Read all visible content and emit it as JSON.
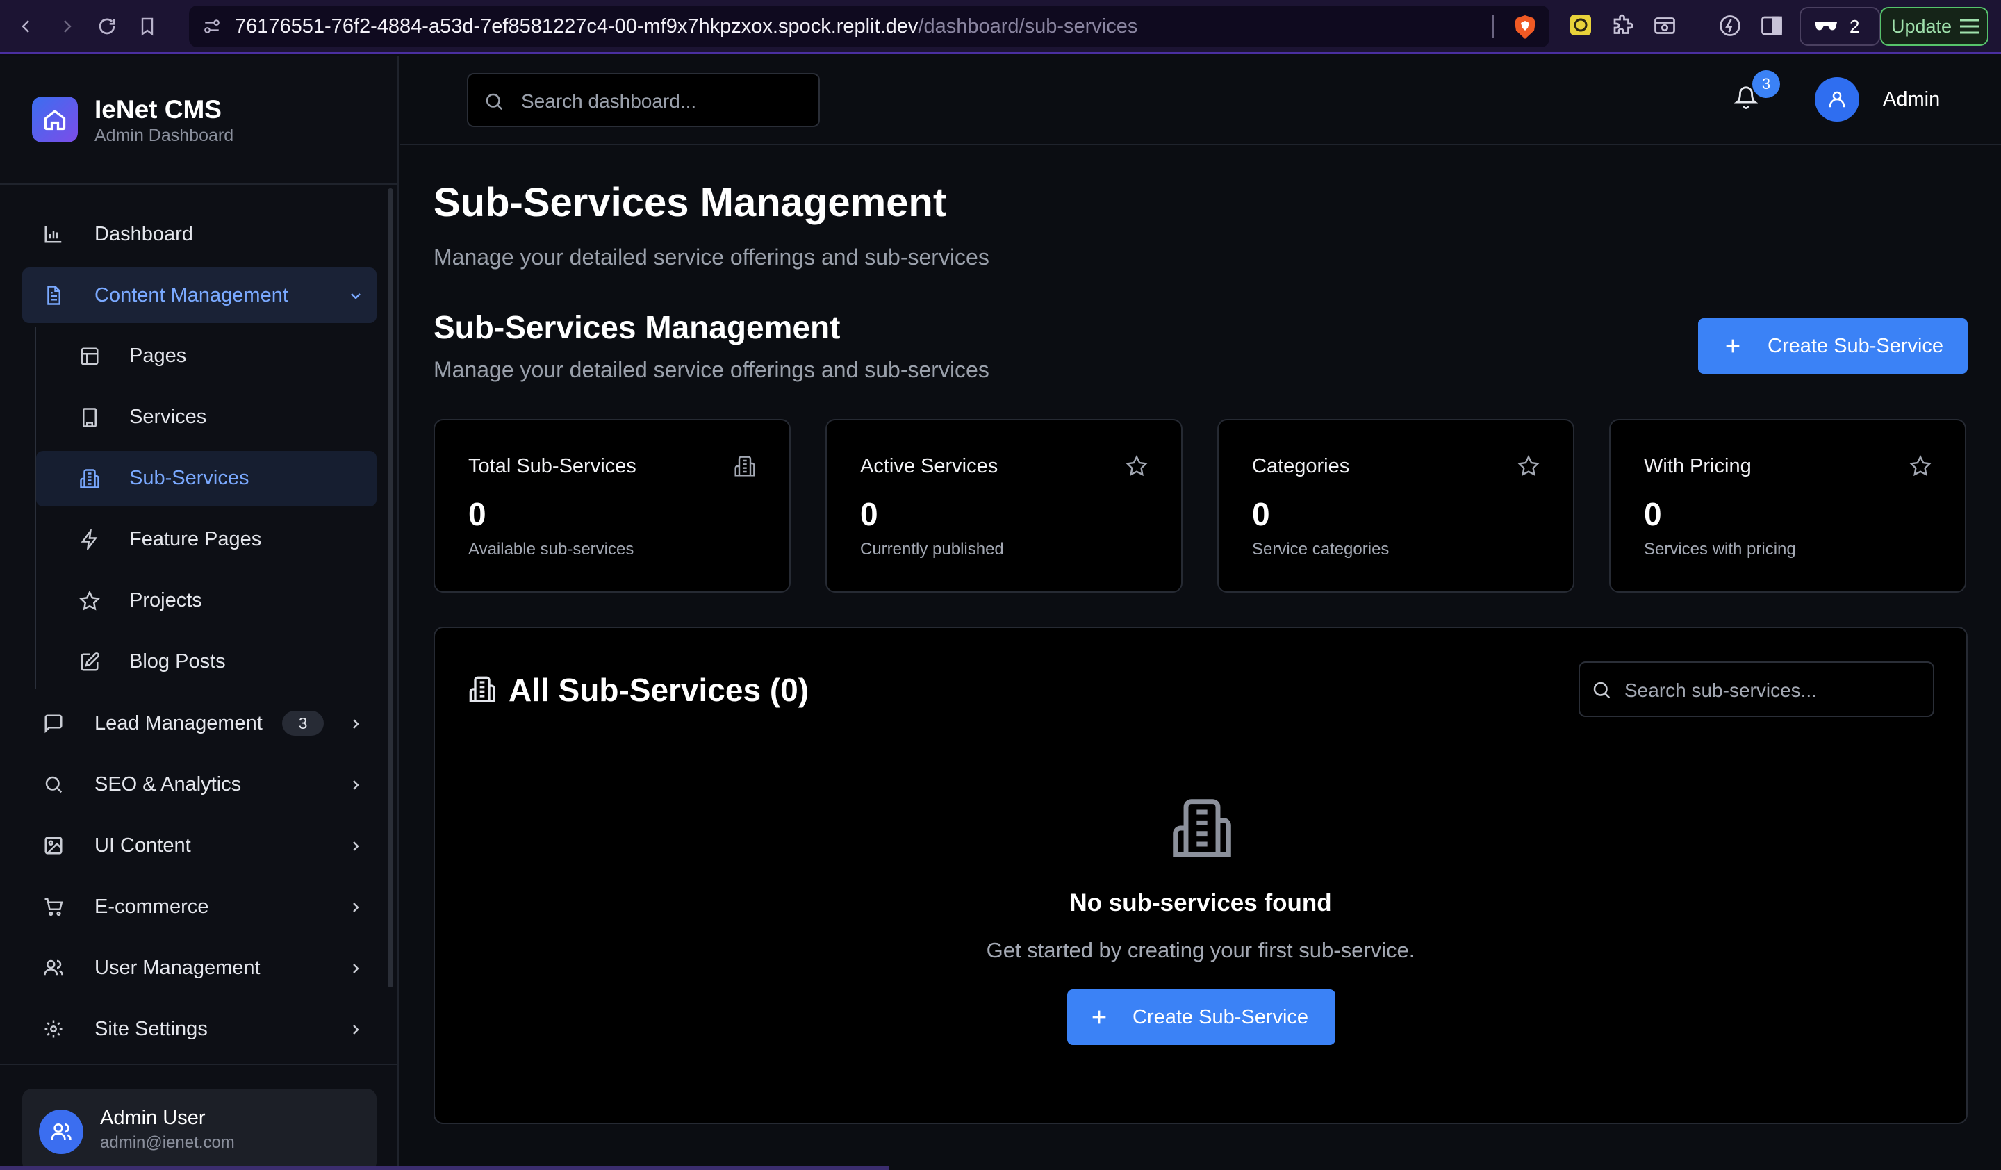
{
  "browser": {
    "url_host": "76176551-76f2-4884-a53d-7ef8581227c4-00-mf9x7hkpzxox.spock.replit.dev",
    "url_path": "/dashboard/sub-services",
    "shield_count": "2",
    "update_label": "Update"
  },
  "brand": {
    "title": "IeNet CMS",
    "subtitle": "Admin Dashboard"
  },
  "sidebar": {
    "items": [
      {
        "label": "Dashboard",
        "icon": "bar-chart-icon"
      },
      {
        "label": "Content Management",
        "icon": "document-icon"
      },
      {
        "label": "Lead Management",
        "icon": "message-icon",
        "badge": "3"
      },
      {
        "label": "SEO & Analytics",
        "icon": "search-icon"
      },
      {
        "label": "UI Content",
        "icon": "image-icon"
      },
      {
        "label": "E-commerce",
        "icon": "cart-icon"
      },
      {
        "label": "User Management",
        "icon": "users-icon"
      },
      {
        "label": "Site Settings",
        "icon": "gear-icon"
      }
    ],
    "sub_items": [
      {
        "label": "Pages",
        "icon": "layout-icon"
      },
      {
        "label": "Services",
        "icon": "building-icon"
      },
      {
        "label": "Sub-Services",
        "icon": "building-2-icon"
      },
      {
        "label": "Feature Pages",
        "icon": "lightning-icon"
      },
      {
        "label": "Projects",
        "icon": "star-icon"
      },
      {
        "label": "Blog Posts",
        "icon": "edit-icon"
      }
    ],
    "user": {
      "name": "Admin User",
      "email": "admin@ienet.com"
    }
  },
  "header": {
    "search_placeholder": "Search dashboard...",
    "notification_count": "3",
    "user_name": "Admin"
  },
  "main": {
    "page_title": "Sub-Services Management",
    "page_subtitle": "Manage your detailed service offerings and sub-services",
    "section_title": "Sub-Services Management",
    "section_subtitle": "Manage your detailed service offerings and sub-services",
    "create_button": "Create Sub-Service",
    "stats": [
      {
        "title": "Total Sub-Services",
        "value": "0",
        "desc": "Available sub-services",
        "icon": "building-icon"
      },
      {
        "title": "Active Services",
        "value": "0",
        "desc": "Currently published",
        "icon": "star-icon"
      },
      {
        "title": "Categories",
        "value": "0",
        "desc": "Service categories",
        "icon": "star-icon"
      },
      {
        "title": "With Pricing",
        "value": "0",
        "desc": "Services with pricing",
        "icon": "star-icon"
      }
    ],
    "list": {
      "title": "All Sub-Services (0)",
      "search_placeholder": "Search sub-services...",
      "empty_title": "No sub-services found",
      "empty_subtitle": "Get started by creating your first sub-service.",
      "empty_button": "Create Sub-Service"
    }
  },
  "colors": {
    "accent": "#3b82f6",
    "background": "#0b0d12",
    "active_text": "#7aa9ff"
  }
}
